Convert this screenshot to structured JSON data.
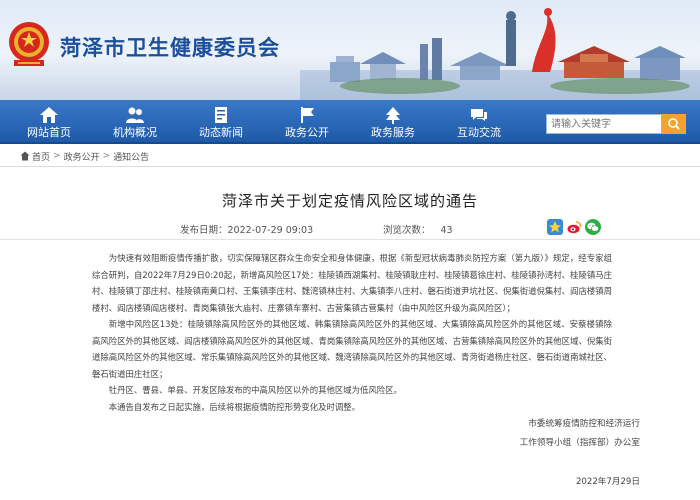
{
  "site": {
    "title": "菏泽市卫生健康委员会"
  },
  "nav": {
    "items": [
      {
        "label": "网站首页",
        "icon": "home-icon"
      },
      {
        "label": "机构概况",
        "icon": "people-icon"
      },
      {
        "label": "动态新闻",
        "icon": "document-icon"
      },
      {
        "label": "政务公开",
        "icon": "flag-icon"
      },
      {
        "label": "政务服务",
        "icon": "tree-icon"
      },
      {
        "label": "互动交流",
        "icon": "chat-icon"
      }
    ],
    "search_placeholder": "请输入关键字"
  },
  "breadcrumb": {
    "home": "首页",
    "section": "政务公开",
    "current": "通知公告"
  },
  "article": {
    "title": "菏泽市关于划定疫情风险区域的通告",
    "publish_label": "发布日期：2022-07-29 09:03",
    "views_label": "浏览次数：",
    "views_value": "43",
    "paragraphs": [
      "为快速有效阻断疫情传播扩散，切实保障辖区群众生命安全和身体健康，根据《新型冠状病毒肺炎防控方案（第九版）》规定，经专家组综合研判，自2022年7月29日0:20起，新增高风险区17处：桂陵镇西湖集村、桂陵镇耿庄村、桂陵镇葛徐庄村、桂陵镇孙湾村、桂陵镇马庄村、桂陵镇丁邵庄村、桂陵镇南黄口村、王集镇李庄村、魏湾镇林庄村、大集镇李八庄村、磐石街道尹坑社区、倪集街道倪集村、阎店楼镇周楼村、阎店楼镇阎店楼村、青岗集镇张大庙村、庄寨镇车寨村、古营集镇古营集村（由中风险区升级为高风险区）；",
      "新增中风险区13处：桂陵镇除高风险区外的其他区域、韩集镇除高风险区外的其他区域、大集镇除高风险区外的其他区域、安蔡楼镇除高风险区外的其他区域、阎店楼镇除高风险区外的其他区域、青岗集镇除高风险区外的其他区域、古营集镇除高风险区外的其他区域、倪集街道除高风险区外的其他区域、常乐集镇除高风险区外的其他区域、魏湾镇除高风险区外的其他区域、青菏街道杨庄社区、磐石街道南城社区、磐石街道田庄社区；",
      "牡丹区、曹县、单县、开发区除发布的中高风险区以外的其他区域为低风险区。",
      "本通告自发布之日起实施，后续将根据疫情防控形势变化及时调整。"
    ],
    "signature": [
      "市委统筹疫情防控和经济运行",
      "工作领导小组（指挥部）办公室",
      "2022年7月29日"
    ]
  },
  "colors": {
    "brand_blue": "#1b4f9c",
    "nav_blue": "#2563b0",
    "accent_orange": "#f2a233"
  }
}
